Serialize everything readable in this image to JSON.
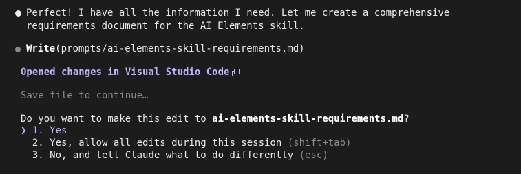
{
  "message": {
    "line1": "Perfect! I have all the information I need. Let me create a comprehensive",
    "line2": "requirements document for the AI Elements skill."
  },
  "tool_call": {
    "name": "Write",
    "args": "(prompts/ai-elements-skill-requirements.md)"
  },
  "panel": {
    "title": "Opened changes in Visual Studio Code",
    "title_icon": "copy-icon",
    "status": "Save file to continue…",
    "question_prefix": "Do you want to make this edit to ",
    "question_file": "ai-elements-skill-requirements.md",
    "question_suffix": "?",
    "selector": "❯",
    "options": [
      {
        "number": "1.",
        "label": "Yes",
        "hint": ""
      },
      {
        "number": "2.",
        "label": "Yes, allow all edits during this session",
        "hint": "(shift+tab)"
      },
      {
        "number": "3.",
        "label": "No, and tell Claude what to do differently",
        "hint": "(esc)"
      }
    ]
  },
  "colors": {
    "background": "#1c1c1c",
    "accent": "#b9b5ff",
    "muted": "#8c8c8c"
  }
}
